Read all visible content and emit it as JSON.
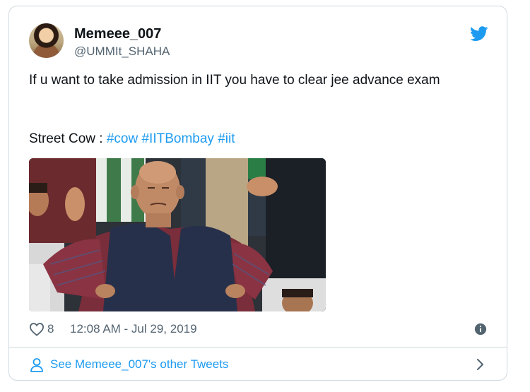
{
  "tweet": {
    "author_name": "Memeee_007",
    "author_handle": "@UMMIt_SHAHA",
    "text_line": "If u want to take admission in IIT you have to clear jee advance exam",
    "street_prefix": "Street Cow : ",
    "hashtags": [
      "#cow",
      "#IITBombay",
      "#iit"
    ],
    "likes": "8",
    "timestamp": "12:08 AM - Jul 29, 2019"
  },
  "footer": {
    "label": "See Memeee_007's other Tweets"
  },
  "icons": {
    "brand": "twitter-bird-icon",
    "like": "heart-icon",
    "info": "info-icon",
    "profile": "person-icon",
    "next": "chevron-right-icon"
  },
  "colors": {
    "accent": "#1d9bf0",
    "text": "#0f1419",
    "muted": "#536471",
    "border": "#cfd9de"
  }
}
